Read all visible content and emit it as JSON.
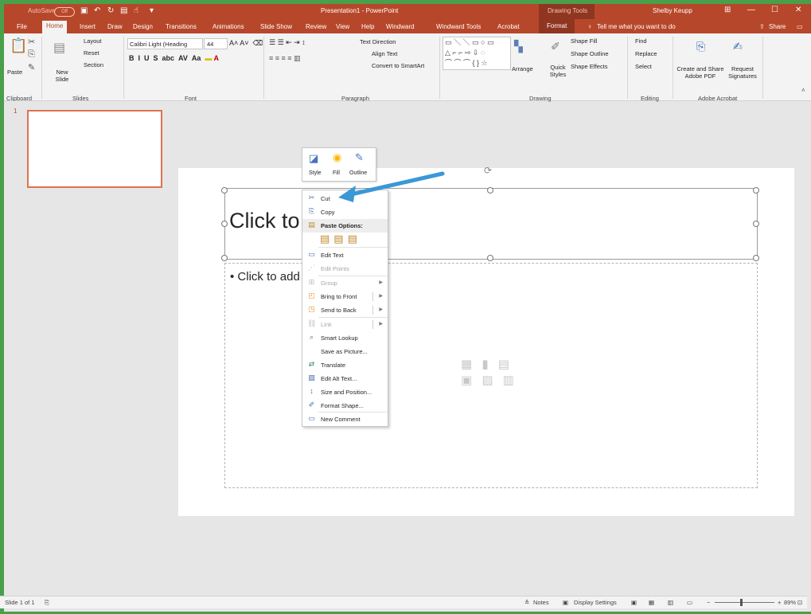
{
  "titlebar": {
    "autosave": "AutoSave",
    "autosave_state": "Off",
    "doc_title": "Presentation1 - PowerPoint",
    "context_tab": "Drawing Tools",
    "user": "Shelby Keupp"
  },
  "tabs": [
    "File",
    "Home",
    "Insert",
    "Draw",
    "Design",
    "Transitions",
    "Animations",
    "Slide Show",
    "Review",
    "View",
    "Help",
    "Windward",
    "Windward Tools",
    "Acrobat",
    "Format"
  ],
  "tell_me": "Tell me what you want to do",
  "share": "Share",
  "ribbon": {
    "clipboard": {
      "paste": "Paste",
      "group": "Clipboard"
    },
    "slides": {
      "new_slide": "New Slide",
      "layout": "Layout",
      "reset": "Reset",
      "section": "Section",
      "group": "Slides"
    },
    "font": {
      "name": "Calibri Light (Heading",
      "size": "44",
      "group": "Font"
    },
    "paragraph": {
      "text_direction": "Text Direction",
      "align_text": "Align Text",
      "convert": "Convert to SmartArt",
      "group": "Paragraph"
    },
    "drawing": {
      "arrange": "Arrange",
      "quick_styles": "Quick Styles",
      "shape_fill": "Shape Fill",
      "shape_outline": "Shape Outline",
      "shape_effects": "Shape Effects",
      "group": "Drawing"
    },
    "editing": {
      "find": "Find",
      "replace": "Replace",
      "select": "Select",
      "group": "Editing"
    },
    "acrobat": {
      "create_share": "Create and Share Adobe PDF",
      "request": "Request Signatures",
      "group": "Adobe Acrobat"
    }
  },
  "thumbnails": {
    "number": "1"
  },
  "slide": {
    "title_placeholder": "Click to add title",
    "body_placeholder": "• Click to add text"
  },
  "minitoolbar": {
    "style": "Style",
    "fill": "Fill",
    "outline": "Outline"
  },
  "context_menu": {
    "items": [
      {
        "label": "Cut",
        "disabled": false
      },
      {
        "label": "Copy",
        "disabled": false
      },
      {
        "label": "Paste Options:",
        "disabled": false
      },
      {
        "label": "Edit Text",
        "disabled": false
      },
      {
        "label": "Edit Points",
        "disabled": true
      },
      {
        "label": "Group",
        "disabled": true
      },
      {
        "label": "Bring to Front",
        "disabled": false
      },
      {
        "label": "Send to Back",
        "disabled": false
      },
      {
        "label": "Link",
        "disabled": true
      },
      {
        "label": "Smart Lookup",
        "disabled": false
      },
      {
        "label": "Save as Picture...",
        "disabled": false
      },
      {
        "label": "Translate",
        "disabled": false
      },
      {
        "label": "Edit Alt Text...",
        "disabled": false
      },
      {
        "label": "Size and Position...",
        "disabled": false
      },
      {
        "label": "Format Shape...",
        "disabled": false
      },
      {
        "label": "New Comment",
        "disabled": false
      }
    ]
  },
  "statusbar": {
    "slide_of": "Slide 1 of 1",
    "notes": "Notes",
    "display": "Display Settings",
    "zoom": "89%"
  },
  "colors": {
    "brand": "#b7472a",
    "arrow": "#3a98d6"
  }
}
